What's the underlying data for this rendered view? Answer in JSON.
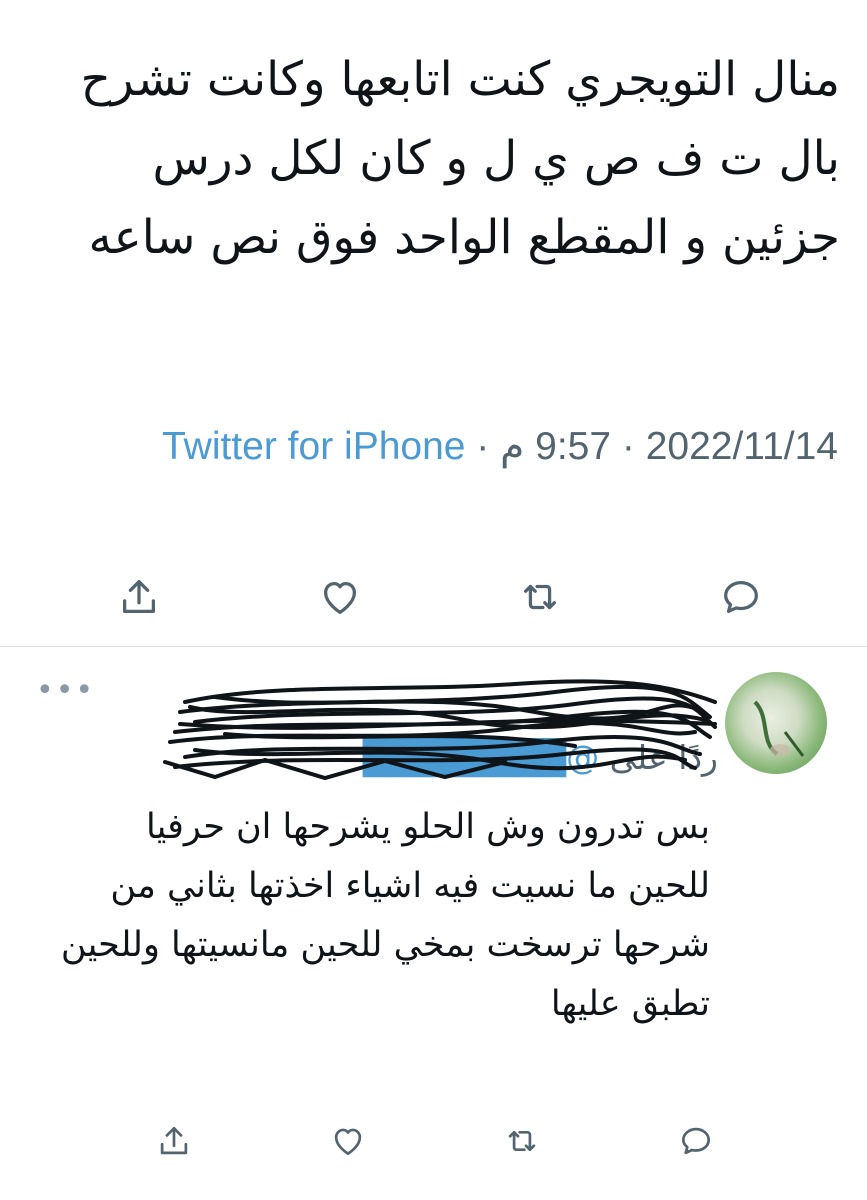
{
  "main_tweet": {
    "text": "منال التويجري كنت اتابعها وكانت تشرح بال ت ف ص ي ل و كان لكل درس جزئين و المقطع الواحد فوق نص ساعه",
    "date": "2022/11/14",
    "time": "9:57 م",
    "separator": " · ",
    "source": "Twitter for iPhone"
  },
  "main_actions": [
    "reply-icon",
    "retweet-icon",
    "like-icon",
    "share-icon"
  ],
  "reply_tweet": {
    "more_label": "•••",
    "replying_to_label": "ردًا على",
    "replying_to_handle": "@████████",
    "text": "بس تدرون وش الحلو يشرحها ان حرفيا للحين ما نسيت فيه اشياء اخذتها بثاني من شرحها ترسخت بمخي للحين مانسيتها وللحين تطبق عليها"
  },
  "colors": {
    "text": "#0f1419",
    "secondary": "#536471",
    "link": "#4a9ad4",
    "icon": "#536471",
    "divider": "#d9dde1"
  }
}
